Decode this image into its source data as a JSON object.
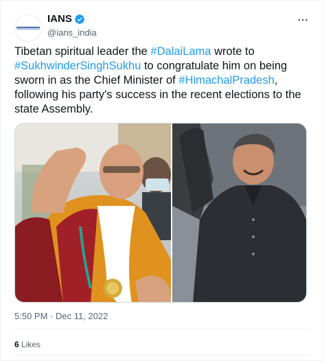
{
  "author": {
    "display_name": "IANS",
    "handle": "@ians_india",
    "verified": true,
    "avatar_icon": "ians-logo-icon"
  },
  "tweet": {
    "segments": [
      {
        "text": "Tibetan spiritual leader the ",
        "type": "text"
      },
      {
        "text": "#DalaiLama",
        "type": "hashtag"
      },
      {
        "text": " wrote to ",
        "type": "text"
      },
      {
        "text": "#SukhwinderSinghSukhu",
        "type": "hashtag"
      },
      {
        "text": " to congratulate him on being sworn in as the Chief Minister of ",
        "type": "text"
      },
      {
        "text": "#HimachalPradesh",
        "type": "hashtag"
      },
      {
        "text": ", following his party's success in the recent elections to the state Assembly.",
        "type": "text"
      }
    ]
  },
  "meta": {
    "timestamp": "5:50 PM · Dec 11, 2022"
  },
  "engagement": {
    "likes_count": "6",
    "likes_label": "Likes"
  },
  "colors": {
    "accent": "#1d9bf0",
    "text": "#0f1419",
    "muted": "#536471"
  }
}
